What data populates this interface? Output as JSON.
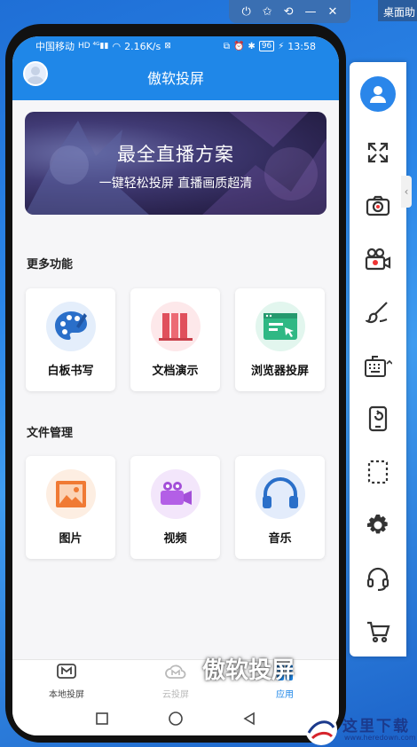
{
  "window": {
    "desktop_label": "桌面助"
  },
  "status_bar": {
    "carrier": "中国移动",
    "net_speed": "2.16K/s",
    "time": "13:58",
    "battery": "96"
  },
  "app": {
    "title": "傲软投屏"
  },
  "banner": {
    "title": "最全直播方案",
    "subtitle": "一键轻松投屏 直播画质超清"
  },
  "more_features": {
    "title": "更多功能",
    "items": [
      {
        "label": "白板书写",
        "icon": "palette-icon"
      },
      {
        "label": "文档演示",
        "icon": "document-icon"
      },
      {
        "label": "浏览器投屏",
        "icon": "browser-icon"
      }
    ]
  },
  "file_management": {
    "title": "文件管理",
    "items": [
      {
        "label": "图片",
        "icon": "image-icon"
      },
      {
        "label": "视频",
        "icon": "video-camera-icon"
      },
      {
        "label": "音乐",
        "icon": "headphones-icon"
      }
    ]
  },
  "bottom_nav": {
    "items": [
      {
        "label": "本地投屏",
        "active": false
      },
      {
        "label": "云投屏",
        "active": false
      },
      {
        "label": "应用",
        "active": true
      }
    ]
  },
  "toolbar": {
    "items": [
      "user-icon",
      "fullscreen-icon",
      "camera-icon",
      "video-record-icon",
      "brush-icon",
      "keyboard-icon",
      "phone-rotate-icon",
      "crop-icon",
      "settings-icon",
      "headset-icon",
      "cart-icon"
    ]
  },
  "overlay": {
    "watermark": "傲软投屏",
    "site_name": "这里下载",
    "site_url": "www.heredown.com"
  },
  "colors": {
    "accent": "#1f87e8",
    "active_nav": "#1f87e8",
    "desktop_bg": "#2b86e8"
  }
}
